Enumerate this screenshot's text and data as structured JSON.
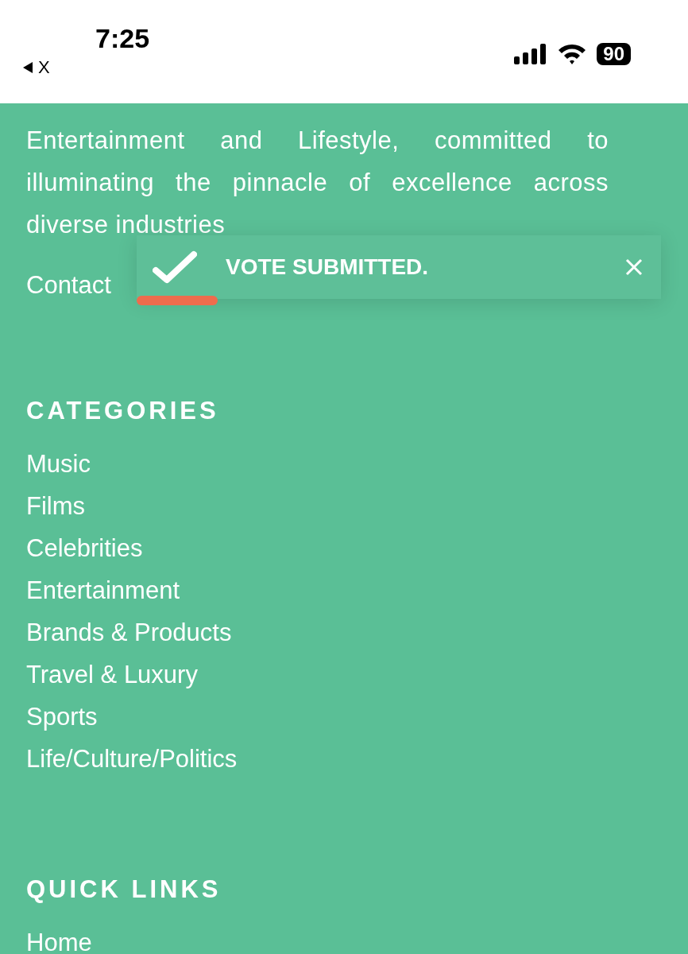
{
  "status_bar": {
    "time": "7:25",
    "back_label": "X",
    "battery": "90"
  },
  "about": {
    "text": "Entertainment and Lifestyle, committed to illuminating the pinnacle of excellence across diverse industries",
    "link": "Contact"
  },
  "sections": [
    {
      "title": "CATEGORIES",
      "links": [
        "Music",
        "Films",
        "Celebrities",
        "Entertainment",
        "Brands & Products",
        "Travel & Luxury",
        "Sports",
        "Life/Culture/Politics"
      ]
    },
    {
      "title": "QUICK LINKS",
      "links": [
        "Home"
      ]
    }
  ],
  "toast": {
    "message": "VOTE SUBMITTED.",
    "level": 0.155
  }
}
